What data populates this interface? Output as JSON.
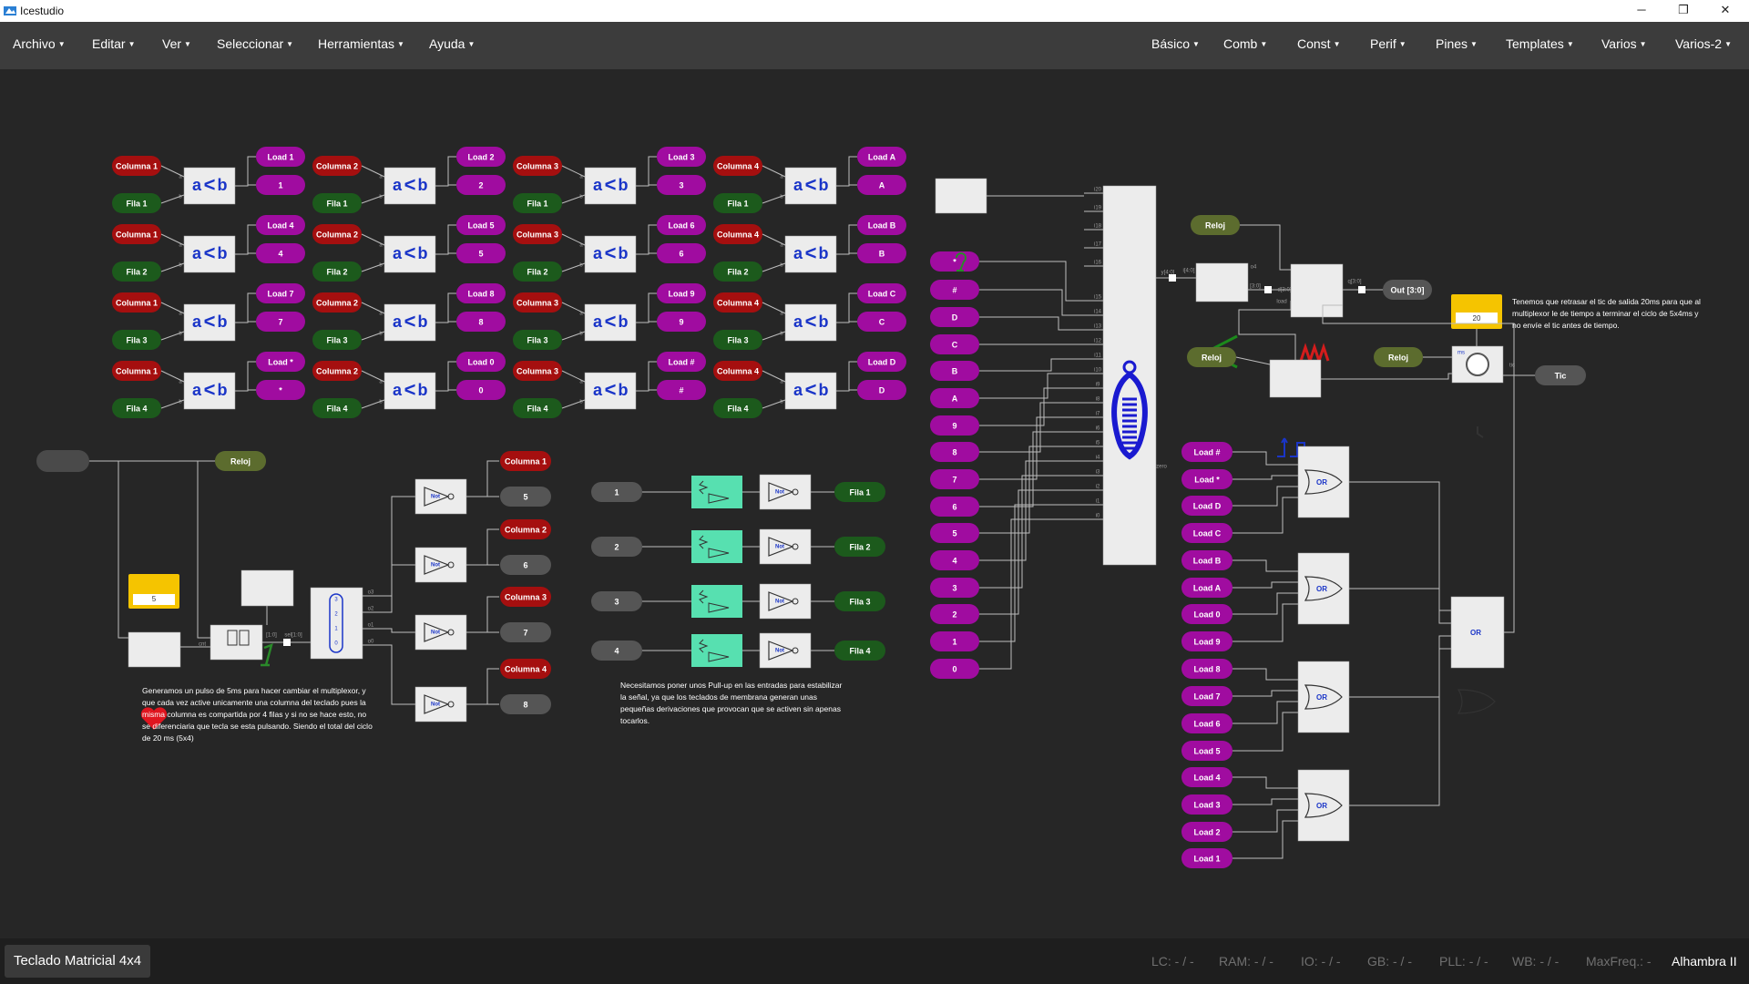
{
  "window": {
    "title": "Icestudio",
    "minimize": "─",
    "restore": "❐",
    "close": "✕"
  },
  "menus_left": [
    "Archivo",
    "Editar",
    "Ver",
    "Seleccionar",
    "Herramientas",
    "Ayuda"
  ],
  "menus_right": [
    "Básico",
    "Comb",
    "Const",
    "Perif",
    "Pines",
    "Templates",
    "Varios",
    "Varios-2"
  ],
  "comparators": {
    "op_a": "a",
    "op_sym": "<",
    "op_b": "b",
    "pin_a": "a",
    "pin_b": "b"
  },
  "keypad_rows": [
    {
      "fila": "Fila 1",
      "columnas": [
        "Columna 1",
        "Columna 2",
        "Columna 3",
        "Columna 4"
      ],
      "loads": [
        "Load 1",
        "Load 2",
        "Load 3",
        "Load A"
      ],
      "keys": [
        "1",
        "2",
        "3",
        "A"
      ]
    },
    {
      "fila": "Fila 2",
      "columnas": [
        "Columna 1",
        "Columna 2",
        "Columna 3",
        "Columna 4"
      ],
      "loads": [
        "Load 4",
        "Load 5",
        "Load 6",
        "Load B"
      ],
      "keys": [
        "4",
        "5",
        "6",
        "B"
      ]
    },
    {
      "fila": "Fila 3",
      "columnas": [
        "Columna 1",
        "Columna 2",
        "Columna 3",
        "Columna 4"
      ],
      "loads": [
        "Load 7",
        "Load 8",
        "Load 9",
        "Load C"
      ],
      "keys": [
        "7",
        "8",
        "9",
        "C"
      ]
    },
    {
      "fila": "Fila 4",
      "columnas": [
        "Columna 1",
        "Columna 2",
        "Columna 3",
        "Columna 4"
      ],
      "loads": [
        "Load *",
        "Load 0",
        "Load #",
        "Load D"
      ],
      "keys": [
        "*",
        "0",
        "#",
        "D"
      ]
    }
  ],
  "encoder_inputs": [
    "*",
    "#",
    "D",
    "C",
    "B",
    "A",
    "9",
    "8",
    "7",
    "6",
    "5",
    "4",
    "3",
    "2",
    "1",
    "0"
  ],
  "encoder_pins": [
    "i15",
    "i14",
    "i13",
    "i12",
    "i11",
    "i10",
    "i9",
    "i8",
    "i7",
    "i6",
    "i5",
    "i4",
    "i3",
    "i2",
    "i1",
    "i0"
  ],
  "encoder_top_pins": [
    "i20",
    "i19",
    "i18",
    "i17",
    "i16"
  ],
  "encoder_zero": "zero",
  "encoder_out_label": "y[4:0]",
  "split": {
    "in": "i[4:0]",
    "out1": "o4",
    "out2": "[3:0]"
  },
  "register": {
    "in": "d[3:0]",
    "out": "q[3:0]",
    "load": "load"
  },
  "reloj_label": "Reloj",
  "out_label": "Out [3:0]",
  "tic_label": "Tic",
  "tic_pins": {
    "ms": "ms",
    "tic": "tic"
  },
  "timer_value": "20",
  "note_top": "Tenemos que retrasar el tic de salida 20ms para que al multiplexor le de tiempo a terminar el ciclo de 5x4ms y no envíe el tic antes de tiempo.",
  "or_label": "OR",
  "or_loads": [
    "Load #",
    "Load *",
    "Load D",
    "Load C",
    "Load B",
    "Load A",
    "Load 0",
    "Load 9",
    "Load 8",
    "Load 7",
    "Load 6",
    "Load 5",
    "Load 4",
    "Load 3",
    "Load 2",
    "Load 1"
  ],
  "mux_section": {
    "columnas": [
      "Columna 1",
      "Columna 2",
      "Columna 3",
      "Columna 4"
    ],
    "values": [
      "5",
      "6",
      "7",
      "8"
    ],
    "not_label": "Not",
    "counter_pins": {
      "cnt": "cnt",
      "bus": "[1:0]",
      "sel": "sel[1:0]"
    },
    "dec_pins": [
      "o3",
      "o2",
      "o1",
      "o0"
    ],
    "dec_digits": [
      "3",
      "2",
      "1",
      "0"
    ],
    "timer_value": "5"
  },
  "note_bottom_left": "Generamos un pulso de 5ms para hacer cambiar el multiplexor, y que cada vez active unicamente una columna del teclado pues la misma columna es compartida por 4 filas y si no se hace esto, no se diferenciaria que tecla se esta pulsando. Siendo el total del ciclo de 20 ms (5x4)",
  "pullup_section": {
    "inputs": [
      "1",
      "2",
      "3",
      "4"
    ],
    "filas": [
      "Fila 1",
      "Fila 2",
      "Fila 3",
      "Fila 4"
    ],
    "not_label": "Not"
  },
  "note_bottom_mid": "Necesitamos poner unos Pull-up en las entradas para estabilizar la señal, ya que los teclados de membrana generan unas pequeñas derivaciones que provocan que se activen sin apenas tocarlos.",
  "footer": {
    "tab": "Teclado Matricial 4x4",
    "stats": [
      "LC: - / -",
      "RAM: - / -",
      "IO: - / -",
      "GB: - / -",
      "PLL: - / -",
      "WB: - / -",
      "MaxFreq.: -"
    ],
    "board": "Alhambra II"
  },
  "colors": {
    "red": "#a50f0f",
    "green": "#1c5a1c",
    "purple": "#a00ca0",
    "olive": "#5c6c2e",
    "gray": "#555555",
    "teal": "#57e0b0",
    "block": "#ececec",
    "wire": "#bdbdbd",
    "canvas": "#262626"
  }
}
